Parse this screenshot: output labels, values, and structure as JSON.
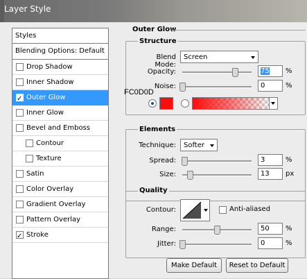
{
  "window": {
    "title": "Layer Style"
  },
  "styles_panel": {
    "header": "Styles",
    "blending": "Blending Options: Default",
    "items": [
      {
        "label": "Drop Shadow",
        "checked": false,
        "selected": false,
        "indent": false
      },
      {
        "label": "Inner Shadow",
        "checked": false,
        "selected": false,
        "indent": false
      },
      {
        "label": "Outer Glow",
        "checked": true,
        "selected": true,
        "indent": false
      },
      {
        "label": "Inner Glow",
        "checked": false,
        "selected": false,
        "indent": false
      },
      {
        "label": "Bevel and Emboss",
        "checked": false,
        "selected": false,
        "indent": false
      },
      {
        "label": "Contour",
        "checked": false,
        "selected": false,
        "indent": true
      },
      {
        "label": "Texture",
        "checked": false,
        "selected": false,
        "indent": true
      },
      {
        "label": "Satin",
        "checked": false,
        "selected": false,
        "indent": false
      },
      {
        "label": "Color Overlay",
        "checked": false,
        "selected": false,
        "indent": false
      },
      {
        "label": "Gradient Overlay",
        "checked": false,
        "selected": false,
        "indent": false
      },
      {
        "label": "Pattern Overlay",
        "checked": false,
        "selected": false,
        "indent": false
      },
      {
        "label": "Stroke",
        "checked": true,
        "selected": false,
        "indent": false
      }
    ]
  },
  "outer_glow": {
    "title": "Outer Glow",
    "structure": {
      "title": "Structure",
      "blend_mode_label": "Blend Mode:",
      "blend_mode_value": "Screen",
      "opacity_label": "Opacity:",
      "opacity_value": "75",
      "opacity_unit": "%",
      "noise_label": "Noise:",
      "noise_value": "0",
      "noise_unit": "%",
      "color_hex_label": "FC0D0D",
      "color": "#fc0d0d"
    },
    "elements": {
      "title": "Elements",
      "technique_label": "Technique:",
      "technique_value": "Softer",
      "spread_label": "Spread:",
      "spread_value": "3",
      "spread_unit": "%",
      "size_label": "Size:",
      "size_value": "13",
      "size_unit": "px"
    },
    "quality": {
      "title": "Quality",
      "contour_label": "Contour:",
      "anti_aliased_label": "Anti-aliased",
      "range_label": "Range:",
      "range_value": "50",
      "range_unit": "%",
      "jitter_label": "Jitter:",
      "jitter_value": "0",
      "jitter_unit": "%"
    },
    "buttons": {
      "make_default": "Make Default",
      "reset_default": "Reset to Default"
    }
  }
}
